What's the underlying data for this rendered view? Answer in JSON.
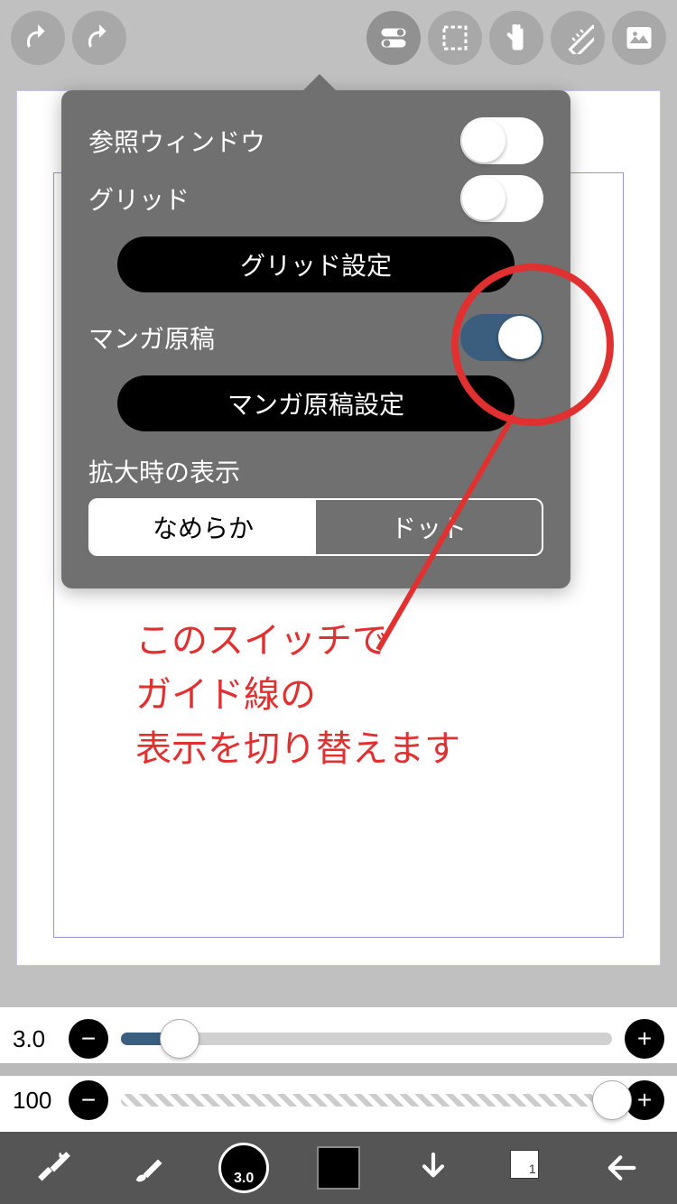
{
  "toolbar": {
    "undo": "undo-icon",
    "redo": "redo-icon",
    "toggles": "toggles-icon",
    "select": "selection-icon",
    "gesture": "gesture-icon",
    "ruler": "ruler-icon",
    "image": "image-icon"
  },
  "popover": {
    "reference_window_label": "参照ウィンドウ",
    "reference_window_on": false,
    "grid_label": "グリッド",
    "grid_on": false,
    "grid_settings_label": "グリッド設定",
    "manga_label": "マンガ原稿",
    "manga_on": true,
    "manga_settings_label": "マンガ原稿設定",
    "zoom_display_label": "拡大時の表示",
    "seg_smooth": "なめらか",
    "seg_dot": "ドット",
    "seg_selected": "smooth"
  },
  "annotation": {
    "line1": "このスイッチで",
    "line2": "ガイド線の",
    "line3": "表示を切り替えます"
  },
  "sliders": {
    "brush_size_value": "3.0",
    "brush_size_pct": 12,
    "opacity_value": "100",
    "opacity_pct": 100
  },
  "bottombar": {
    "brush_size_badge": "3.0",
    "layer_number": "1"
  },
  "colors": {
    "accent": "#3b5e7e",
    "annotation": "#e03030"
  }
}
